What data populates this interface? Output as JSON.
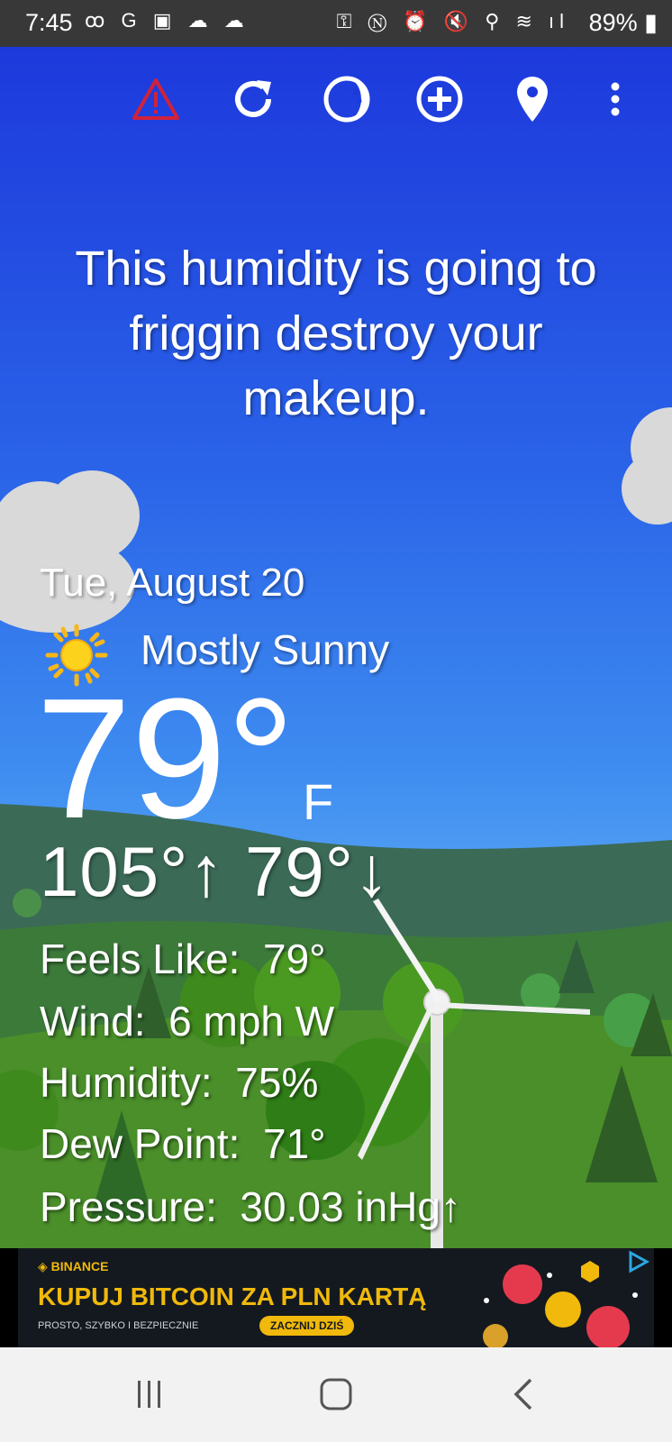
{
  "status_bar": {
    "time": "7:45",
    "left_icons": "ꝏ G ▣ ☁ ☁",
    "right_icons": "⚿ Ⓝ ⏰ 🔇 ⚲ ≋ ıl",
    "battery": "89%"
  },
  "toolbar": {
    "icons": [
      "warning-icon",
      "refresh-icon",
      "theme-icon",
      "add-location-icon",
      "location-pin-icon",
      "more-icon"
    ],
    "warning_color": "#d0223c"
  },
  "headline": "This humidity is going to friggin destroy your makeup.",
  "weather": {
    "date": "Tue, August 20",
    "condition": "Mostly Sunny",
    "temperature": "79°",
    "unit": "F",
    "high": "105°↑",
    "low": "79°↓",
    "details": [
      {
        "label": "Feels Like:",
        "value": "79°"
      },
      {
        "label": "Wind:",
        "value": "6 mph W"
      },
      {
        "label": "Humidity:",
        "value": "75%"
      },
      {
        "label": "Dew Point:",
        "value": "71°"
      },
      {
        "label": "Pressure:",
        "value": "30.03 inHg↑"
      }
    ]
  },
  "ad": {
    "brand": "◈ BINANCE",
    "headline": "KUPUJ BITCOIN ZA PLN KARTĄ",
    "subtitle": "PROSTO, SZYBKO I BEZPIECZNIE",
    "cta": "ZACZNIJ DZIŚ",
    "accent": "#f0b90b"
  },
  "nav_bar": {
    "icons": [
      "recent-apps-icon",
      "home-icon",
      "back-icon"
    ]
  }
}
